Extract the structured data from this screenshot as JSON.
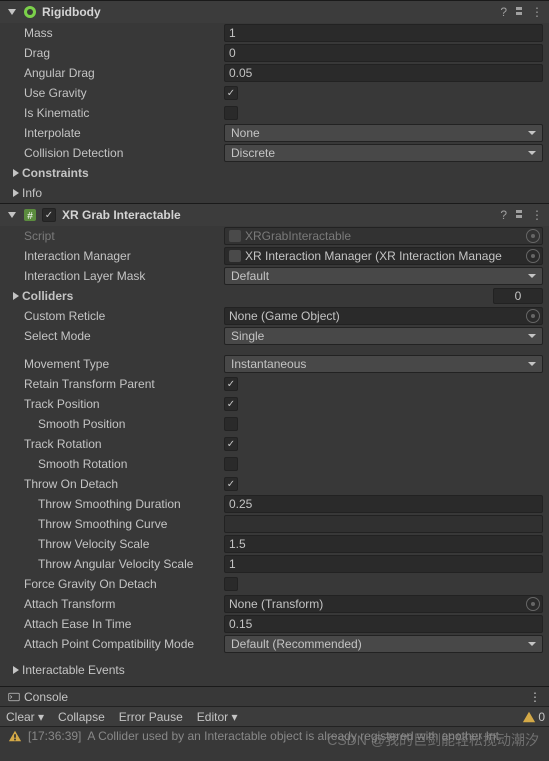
{
  "rigidbody": {
    "title": "Rigidbody",
    "mass_label": "Mass",
    "mass": "1",
    "drag_label": "Drag",
    "drag": "0",
    "angular_drag_label": "Angular Drag",
    "angular_drag": "0.05",
    "use_gravity_label": "Use Gravity",
    "use_gravity": true,
    "is_kinematic_label": "Is Kinematic",
    "is_kinematic": false,
    "interpolate_label": "Interpolate",
    "interpolate": "None",
    "collision_detection_label": "Collision Detection",
    "collision_detection": "Discrete",
    "constraints_label": "Constraints",
    "info_label": "Info"
  },
  "xrgrab": {
    "title": "XR Grab Interactable",
    "script_label": "Script",
    "script": "XRGrabInteractable",
    "interaction_manager_label": "Interaction Manager",
    "interaction_manager": "XR Interaction Manager (XR Interaction Manage",
    "interaction_layer_mask_label": "Interaction Layer Mask",
    "interaction_layer_mask": "Default",
    "colliders_label": "Colliders",
    "colliders_count": "0",
    "custom_reticle_label": "Custom Reticle",
    "custom_reticle": "None (Game Object)",
    "select_mode_label": "Select Mode",
    "select_mode": "Single",
    "movement_type_label": "Movement Type",
    "movement_type": "Instantaneous",
    "retain_transform_parent_label": "Retain Transform Parent",
    "retain_transform_parent": true,
    "track_position_label": "Track Position",
    "track_position": true,
    "smooth_position_label": "Smooth Position",
    "smooth_position": false,
    "track_rotation_label": "Track Rotation",
    "track_rotation": true,
    "smooth_rotation_label": "Smooth Rotation",
    "smooth_rotation": false,
    "throw_on_detach_label": "Throw On Detach",
    "throw_on_detach": true,
    "throw_smoothing_duration_label": "Throw Smoothing Duration",
    "throw_smoothing_duration": "0.25",
    "throw_smoothing_curve_label": "Throw Smoothing Curve",
    "throw_velocity_scale_label": "Throw Velocity Scale",
    "throw_velocity_scale": "1.5",
    "throw_angular_velocity_scale_label": "Throw Angular Velocity Scale",
    "throw_angular_velocity_scale": "1",
    "force_gravity_on_detach_label": "Force Gravity On Detach",
    "force_gravity_on_detach": false,
    "attach_transform_label": "Attach Transform",
    "attach_transform": "None (Transform)",
    "attach_ease_in_time_label": "Attach Ease In Time",
    "attach_ease_in_time": "0.15",
    "attach_point_compatibility_mode_label": "Attach Point Compatibility Mode",
    "attach_point_compatibility_mode": "Default (Recommended)",
    "interactable_events_label": "Interactable Events"
  },
  "console": {
    "tab_label": "Console",
    "clear": "Clear",
    "collapse": "Collapse",
    "error_pause": "Error Pause",
    "editor": "Editor",
    "count_warn": "0",
    "msg_time": "[17:36:39]",
    "msg_text": "A Collider used by an Interactable object is already registered with another Int"
  },
  "watermark": "CSDN @我的巨剑能轻松搅动潮汐"
}
